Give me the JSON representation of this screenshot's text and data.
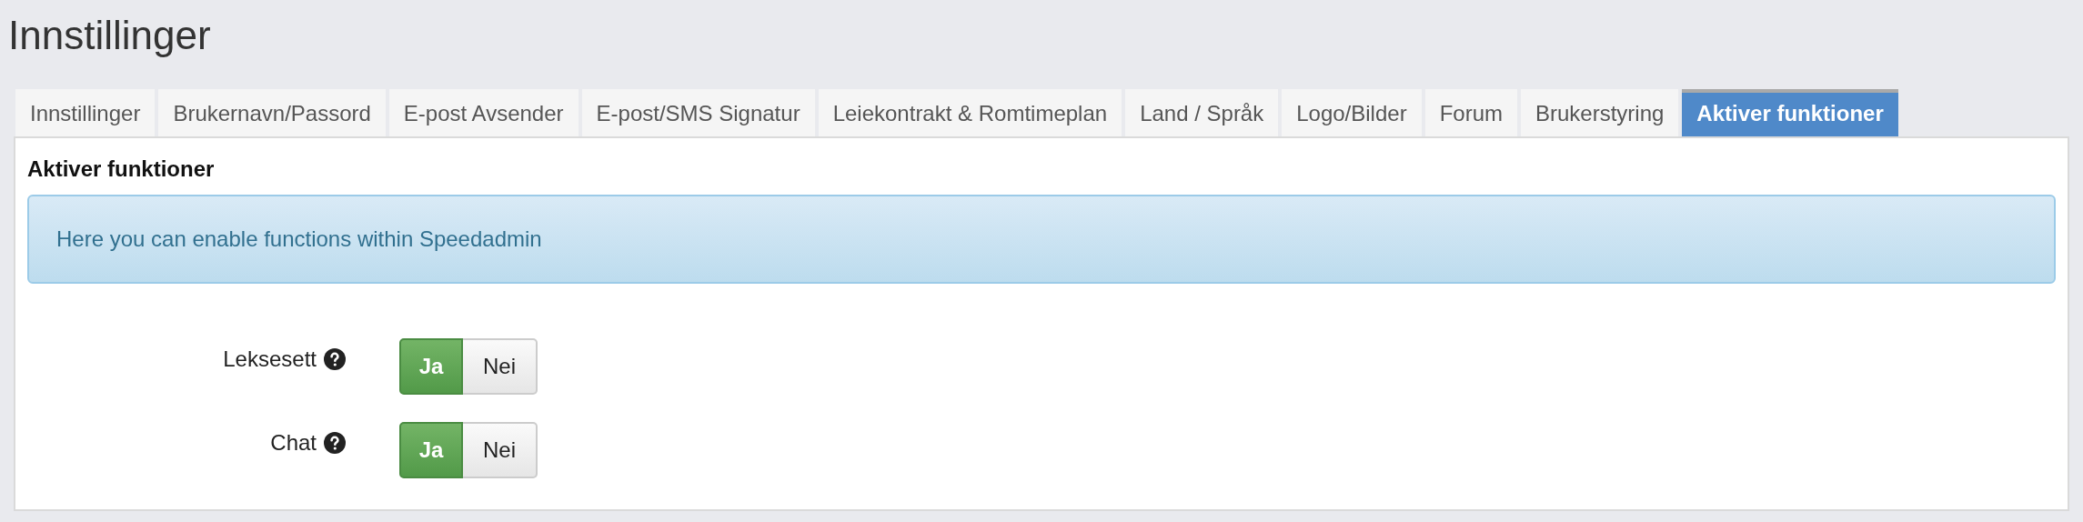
{
  "page_title": "Innstillinger",
  "tabs": [
    {
      "label": "Innstillinger",
      "selected": false
    },
    {
      "label": "Brukernavn/Passord",
      "selected": false
    },
    {
      "label": "E-post Avsender",
      "selected": false
    },
    {
      "label": "E-post/SMS Signatur",
      "selected": false
    },
    {
      "label": "Leiekontrakt & Romtimeplan",
      "selected": false
    },
    {
      "label": "Land / Språk",
      "selected": false
    },
    {
      "label": "Logo/Bilder",
      "selected": false
    },
    {
      "label": "Forum",
      "selected": false
    },
    {
      "label": "Brukerstyring",
      "selected": false
    },
    {
      "label": "Aktiver funktioner",
      "selected": true
    }
  ],
  "section_title": "Aktiver funktioner",
  "info_message": "Here you can enable functions within Speedadmin",
  "settings": [
    {
      "label": "Leksesett",
      "options": [
        {
          "label": "Ja",
          "selected": true
        },
        {
          "label": "Nei",
          "selected": false
        }
      ]
    },
    {
      "label": "Chat",
      "options": [
        {
          "label": "Ja",
          "selected": true
        },
        {
          "label": "Nei",
          "selected": false
        }
      ]
    }
  ]
}
